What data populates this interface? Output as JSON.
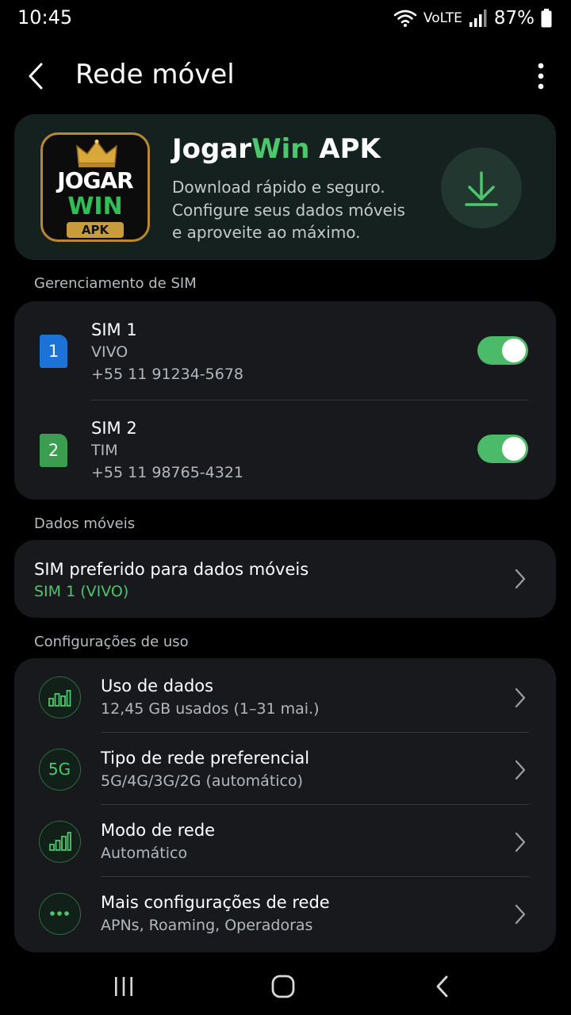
{
  "status": {
    "time": "10:45",
    "network": "VoLTE",
    "battery": "87%"
  },
  "header": {
    "title": "Rede móvel"
  },
  "promo": {
    "logo_text_top": "JOGAR",
    "logo_text_bottom": "WIN",
    "logo_badge": "APK",
    "title_part1": "Jogar",
    "title_part2": "Win",
    "title_part3": " APK",
    "desc_line1": "Download rápido e seguro.",
    "desc_line2": "Configure seus dados móveis",
    "desc_line3": "e aproveite ao máximo."
  },
  "sim_section": {
    "label": "Gerenciamento de SIM",
    "sims": [
      {
        "badge": "1",
        "title": "SIM 1",
        "carrier": "VIVO",
        "number": "+55 11 91234-5678",
        "enabled": true,
        "color": "#1d72d8"
      },
      {
        "badge": "2",
        "title": "SIM 2",
        "carrier": "TIM",
        "number": "+55 11 98765-4321",
        "enabled": true,
        "color": "#3a9d4f"
      }
    ]
  },
  "data_section": {
    "label": "Dados móveis",
    "preferred_title": "SIM preferido para dados móveis",
    "preferred_value": "SIM 1 (VIVO)"
  },
  "usage_section": {
    "label": "Configurações de uso",
    "items": [
      {
        "icon": "bar-chart-icon",
        "title": "Uso de dados",
        "subtitle": "12,45 GB usados (1–31 mai.)"
      },
      {
        "icon": "5g-icon",
        "icon_text": "5G",
        "title": "Tipo de rede preferencial",
        "subtitle": "5G/4G/3G/2G (automático)"
      },
      {
        "icon": "signal-bars-icon",
        "title": "Modo de rede",
        "subtitle": "Automático"
      },
      {
        "icon": "more-dots-icon",
        "title": "Mais configurações de rede",
        "subtitle": "APNs, Roaming, Operadoras"
      }
    ]
  },
  "colors": {
    "accent": "#4cc76d",
    "card": "#17191c",
    "toggle_on": "#4cbb69"
  }
}
